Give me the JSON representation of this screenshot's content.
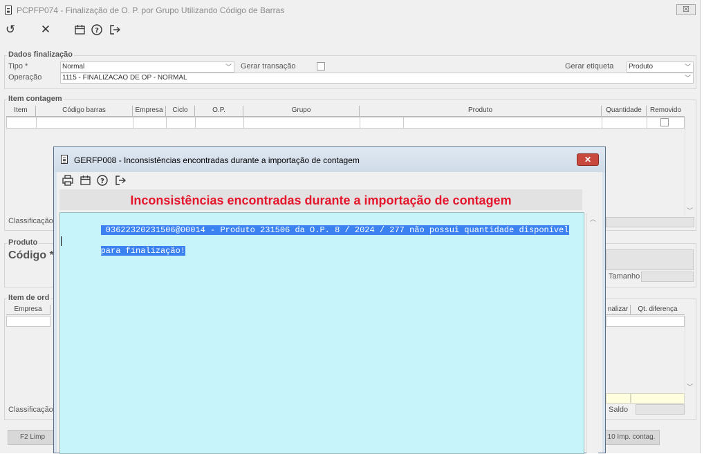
{
  "main_window": {
    "title": "PCPFP074 - Finalização de O. P.  por Grupo Utilizando Código de Barras",
    "close_label": "☒"
  },
  "toolbar": {
    "icons": [
      "undo-icon",
      "close-icon",
      "calendar-icon",
      "help-icon",
      "exit-icon"
    ]
  },
  "dados": {
    "title": "Dados finalização",
    "tipo_label": "Tipo *",
    "tipo_value": "Normal",
    "gerar_transacao_label": "Gerar transação",
    "gerar_etiqueta_label": "Gerar etiqueta",
    "gerar_etiqueta_value": "Produto",
    "operacao_label": "Operação",
    "operacao_value": "1115 - FINALIZACAO DE OP - NORMAL"
  },
  "item_contagem": {
    "title": "Item contagem",
    "columns": [
      "Item",
      "Código barras",
      "Empresa",
      "Ciclo",
      "O.P.",
      "Grupo",
      "Produto",
      "Quantidade",
      "Removido"
    ],
    "classificacao_label": "Classificação"
  },
  "produto": {
    "title": "Produto",
    "codigo_label": "Código *",
    "tamanho_label": "Tamanho"
  },
  "item_ordem": {
    "title": "Item de ord",
    "col_empresa": "Empresa",
    "col_finalizar": "nalizar",
    "col_diferenca": "Qt. diferença",
    "classificacao_label": "Classificação",
    "saldo_label": "Saldo"
  },
  "buttons": {
    "f2_label": "F2 Limp",
    "f10_label": "10 Imp. contag."
  },
  "dialog": {
    "title": "GERFP008 - Inconsistências encontradas durante a importação de contagem",
    "close_label": "✕",
    "heading": "Inconsistências encontradas durante a importação de contagem",
    "line1": " 03622320231506@00014 - Produto 231506 da O.P. 8 / 2024 / 277 não possui quantidade disponível",
    "line2": "para finalização!",
    "toolbar_icons": [
      "print-icon",
      "calendar-icon",
      "help-icon",
      "exit-icon"
    ]
  },
  "colors": {
    "heading_red": "#e5172d",
    "memo_bg": "#c6f4fa",
    "selection_blue": "#3b82f0"
  }
}
